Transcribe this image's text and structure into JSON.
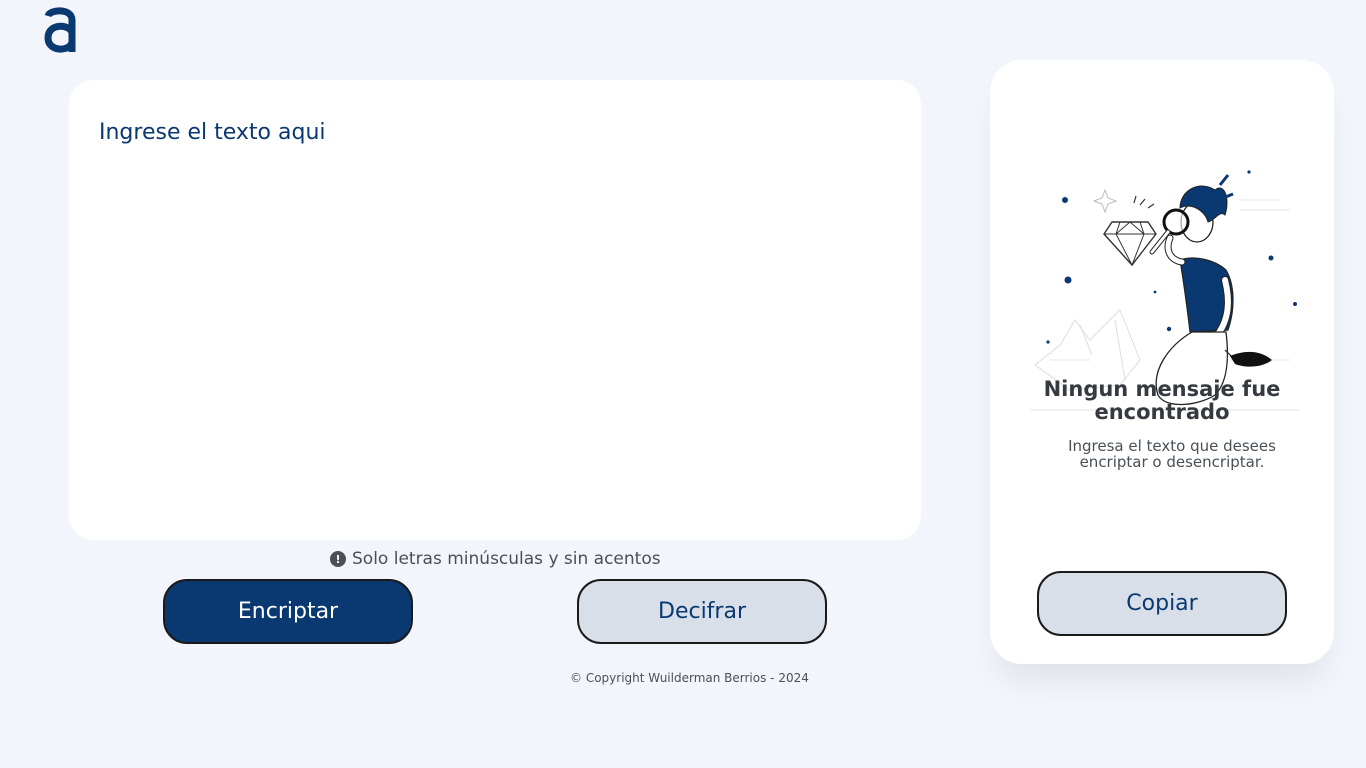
{
  "brand": {
    "logo_letter": "a",
    "color": "#0a3871"
  },
  "input": {
    "placeholder": "Ingrese el texto aqui",
    "value": ""
  },
  "hint": {
    "icon": "exclamation-circle-icon",
    "text": "Solo letras minúsculas y sin acentos"
  },
  "buttons": {
    "encrypt": "Encriptar",
    "decrypt": "Decifrar",
    "copy": "Copiar"
  },
  "output": {
    "title": "Ningun mensaje fue encontrado",
    "text": "Ingresa el texto que desees encriptar o desencriptar.",
    "illustration": "person-searching-with-magnifier-illustration"
  },
  "footer": {
    "text": "© Copyright Wuilderman Berrios - 2024"
  },
  "colors": {
    "background": "#f3f5fc",
    "primary": "#0a3871",
    "secondary": "#d8dfe8",
    "text": "#495057"
  }
}
